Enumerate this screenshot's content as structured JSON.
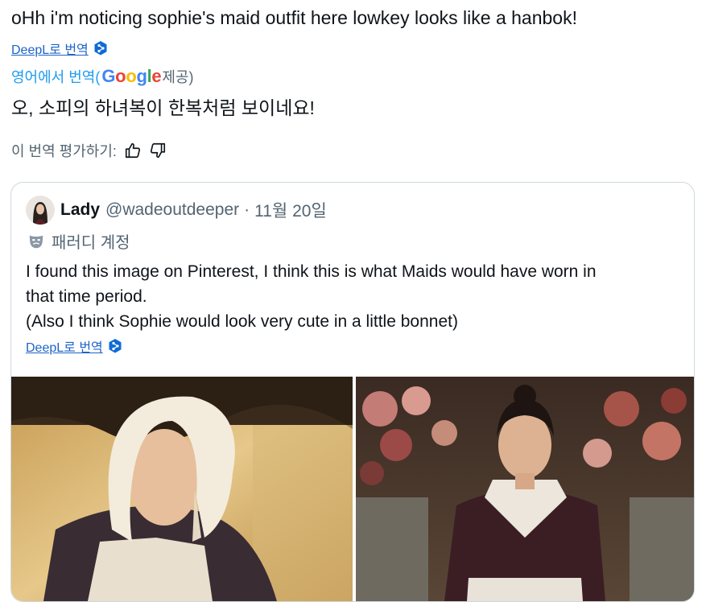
{
  "post": {
    "text": "oHh i'm noticing sophie's maid outfit here lowkey looks like a hanbok!",
    "deepl_label": "DeepL로 번역",
    "google_prefix": "영어에서 번역(",
    "google_word": "Google",
    "google_suffix": " 제공)",
    "translated_text": "오, 소피의 하녀복이 한복처럼 보이네요!",
    "rate_label": "이 번역 평가하기:"
  },
  "quote": {
    "name": "Lady",
    "handle": "@wadeoutdeeper",
    "separator": "·",
    "date": "11월 20일",
    "parody_label": "패러디 계정",
    "body_lines": [
      "I found this image on Pinterest, I think this is what Maids would have worn in",
      "that time period.",
      "(Also I think Sophie would look very cute in a little bonnet)"
    ],
    "deepl_label": "DeepL로 번역"
  },
  "colors": {
    "link": "#1d64c8",
    "muted": "#536471",
    "border": "#cfd9de",
    "deepl": "#0f6bd6"
  },
  "icons": {
    "deepl": "deepl-logo-icon",
    "thumbs_up": "thumbs-up-icon",
    "thumbs_down": "thumbs-down-icon",
    "parody": "theater-mask-icon"
  }
}
